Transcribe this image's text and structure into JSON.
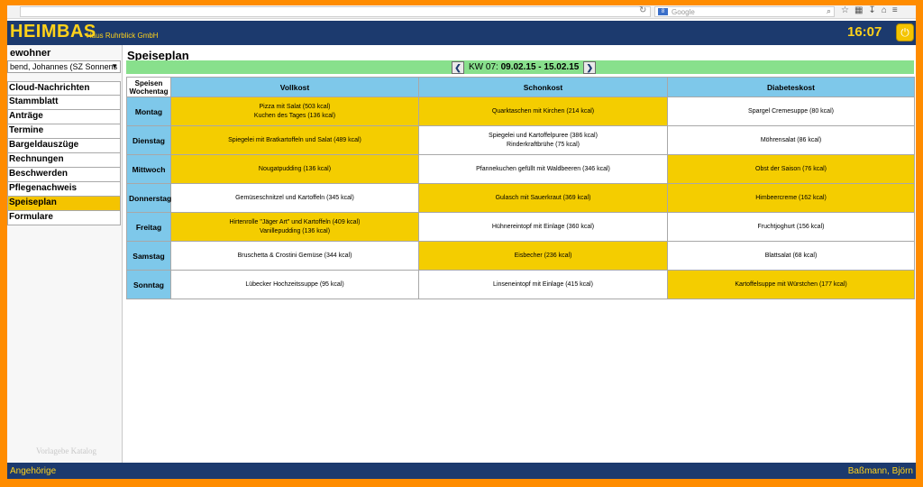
{
  "browser": {
    "search_placeholder": "Google",
    "search_engine_icon": "google-icon"
  },
  "header": {
    "logo": "HEIMBAS",
    "logo_sub": "Haus Ruhrblick GmbH",
    "clock": "16:07",
    "power_icon": "power-icon"
  },
  "sidebar": {
    "label": "ewohner",
    "resident": "bend, Johannes (SZ Sonnens",
    "items": [
      "Cloud-Nachrichten",
      "Stammblatt",
      "Anträge",
      "Termine",
      "Bargeldauszüge",
      "Rechnungen",
      "Beschwerden",
      "Pflegenachweis",
      "Speiseplan",
      "Formulare"
    ],
    "active": "Speiseplan",
    "watermark": "Vorlagebe Katalog"
  },
  "main": {
    "title": "Speiseplan",
    "week_prefix": "KW 07:",
    "week_range": "09.02.15 - 15.02.15",
    "corner_top": "Speisen",
    "corner_bottom": "Wochentag",
    "columns": [
      "Vollkost",
      "Schonkost",
      "Diabeteskost"
    ],
    "rows": [
      {
        "day": "Montag",
        "cells": [
          {
            "lines": [
              "Pizza mit Salat (503 kcal)",
              "Kuchen des Tages (136 kcal)"
            ],
            "highlight": true
          },
          {
            "lines": [
              "Quarktaschen mit Kirchen (214 kcal)"
            ],
            "highlight": true
          },
          {
            "lines": [
              "Spargel Cremesuppe (80 kcal)"
            ],
            "highlight": false
          }
        ]
      },
      {
        "day": "Dienstag",
        "cells": [
          {
            "lines": [
              "Spiegelei mit Bratkartoffeln und Salat (489 kcal)"
            ],
            "highlight": true
          },
          {
            "lines": [
              "Spiegelei und Kartoffelpuree (386 kcal)",
              "Rinderkraftbrühe (75 kcal)"
            ],
            "highlight": false
          },
          {
            "lines": [
              "Möhrensalat (86 kcal)"
            ],
            "highlight": false
          }
        ]
      },
      {
        "day": "Mittwoch",
        "cells": [
          {
            "lines": [
              "Nougatpudding (136 kcal)"
            ],
            "highlight": true
          },
          {
            "lines": [
              "Pfannekuchen gefüllt mit Waldbeeren (346 kcal)"
            ],
            "highlight": false
          },
          {
            "lines": [
              "Obst der Saison (76 kcal)"
            ],
            "highlight": true
          }
        ]
      },
      {
        "day": "Donnerstag",
        "cells": [
          {
            "lines": [
              "Gemüseschnitzel und Kartoffeln (345 kcal)"
            ],
            "highlight": false
          },
          {
            "lines": [
              "Gulasch mit Sauerkraut (369 kcal)"
            ],
            "highlight": true
          },
          {
            "lines": [
              "Himbeercreme (162 kcal)"
            ],
            "highlight": true
          }
        ]
      },
      {
        "day": "Freitag",
        "cells": [
          {
            "lines": [
              "Hirtenrolle \"Jäger Art\" und Kartoffeln (409 kcal)",
              "Vanillepudding (136 kcal)"
            ],
            "highlight": true
          },
          {
            "lines": [
              "Hühnereintopf mit Einlage (360 kcal)"
            ],
            "highlight": false
          },
          {
            "lines": [
              "Fruchtjoghurt (156 kcal)"
            ],
            "highlight": false
          }
        ]
      },
      {
        "day": "Samstag",
        "cells": [
          {
            "lines": [
              "Bruschetta & Crostini Gemüse (344 kcal)"
            ],
            "highlight": false
          },
          {
            "lines": [
              "Eisbecher (236 kcal)"
            ],
            "highlight": true
          },
          {
            "lines": [
              "Blattsalat (68 kcal)"
            ],
            "highlight": false
          }
        ]
      },
      {
        "day": "Sonntag",
        "cells": [
          {
            "lines": [
              "Lübecker Hochzeitssuppe (95 kcal)"
            ],
            "highlight": false
          },
          {
            "lines": [
              "Linseneintopf mit Einlage (415 kcal)"
            ],
            "highlight": false
          },
          {
            "lines": [
              "Kartoffelsuppe mit Würstchen (177 kcal)"
            ],
            "highlight": true
          }
        ]
      }
    ]
  },
  "footer": {
    "left": "Angehörige",
    "right": "Baßmann, Björn"
  },
  "colors": {
    "accent": "#f4c400",
    "header": "#1c3a6e",
    "week_bar": "#88e08c",
    "table_head": "#7ec8ea",
    "outer_frame": "#ff8c00"
  }
}
